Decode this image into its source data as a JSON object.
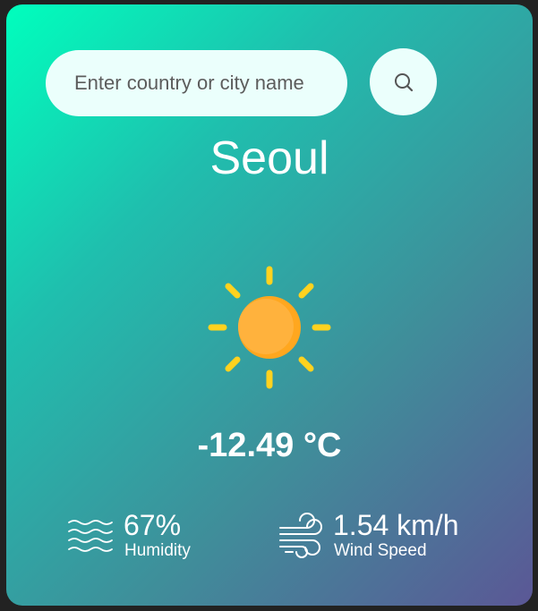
{
  "search": {
    "placeholder": "Enter country or city name",
    "button_icon": "search-icon"
  },
  "weather": {
    "city": "Seoul",
    "temperature": "-12.49 °C",
    "condition_icon": "sun-icon"
  },
  "stats": {
    "humidity": {
      "value": "67%",
      "label": "Humidity",
      "icon": "humidity-waves-icon"
    },
    "wind": {
      "value": "1.54 km/h",
      "label": "Wind Speed",
      "icon": "wind-icon"
    }
  },
  "colors": {
    "gradient_start": "#00ffbd",
    "gradient_end": "#5b5796",
    "sun_core": "#ffb03a",
    "sun_rays": "#ffd21f",
    "input_bg": "#ebfffc",
    "text": "#ffffff"
  }
}
